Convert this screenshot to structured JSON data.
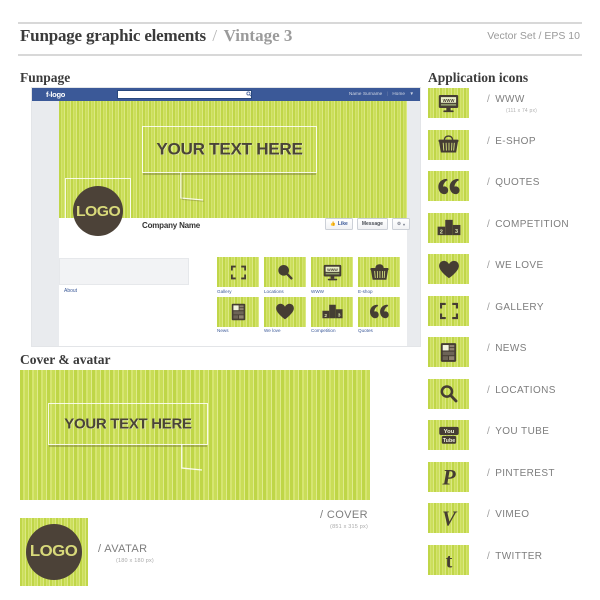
{
  "header": {
    "title_main": "Funpage graphic elements",
    "title_slash": "/",
    "title_sub": "Vintage 3",
    "right_note": "Vector Set / EPS 10"
  },
  "sections": {
    "funpage_heading": "Funpage",
    "cover_heading": "Cover & avatar",
    "appicons_heading": "Application icons"
  },
  "funpage": {
    "brand": "f-logo",
    "search_placeholder": "",
    "search_icon": "search-icon",
    "user_name": "Name Surname",
    "separator": "|",
    "home_label": "Home",
    "caret": "▼",
    "bubble_text": "YOUR TEXT HERE",
    "logo_text": "LOGO",
    "company_name": "Company Name",
    "like_label": "Like",
    "like_icon": "thumbs-up-icon",
    "message_label": "Message",
    "gear_icon": "gear-icon",
    "caret_icon": "chevron-down-icon",
    "about_label": "About",
    "grid": [
      {
        "label": "Gallery",
        "icon": "gallery-icon"
      },
      {
        "label": "Locations",
        "icon": "magnifier-icon"
      },
      {
        "label": "WWW",
        "icon": "monitor-www-icon"
      },
      {
        "label": "E-shop",
        "icon": "basket-icon"
      },
      {
        "label": "News",
        "icon": "newspaper-icon"
      },
      {
        "label": "We love",
        "icon": "heart-icon"
      },
      {
        "label": "Competition",
        "icon": "podium-icon"
      },
      {
        "label": "Quotes",
        "icon": "quotes-icon"
      }
    ]
  },
  "cover": {
    "bubble_text": "YOUR TEXT HERE",
    "label": "/  COVER",
    "dimensions": "(851 x 315 px)"
  },
  "avatar": {
    "logo_text": "LOGO",
    "label": "/  AVATAR",
    "dimensions": "(180 x 180 px)"
  },
  "app_icons": {
    "first_dimensions": "(111 x 74 px)",
    "items": [
      {
        "slash": "/",
        "label": "WWW",
        "icon": "monitor-www-icon"
      },
      {
        "slash": "/",
        "label": "E-SHOP",
        "icon": "basket-icon"
      },
      {
        "slash": "/",
        "label": "QUOTES",
        "icon": "quotes-icon"
      },
      {
        "slash": "/",
        "label": "COMPETITION",
        "icon": "podium-icon"
      },
      {
        "slash": "/",
        "label": "WE LOVE",
        "icon": "heart-icon"
      },
      {
        "slash": "/",
        "label": "GALLERY",
        "icon": "gallery-icon"
      },
      {
        "slash": "/",
        "label": "NEWS",
        "icon": "newspaper-icon"
      },
      {
        "slash": "/",
        "label": "LOCATIONS",
        "icon": "magnifier-icon"
      },
      {
        "slash": "/",
        "label": "YOU TUBE",
        "icon": "youtube-icon"
      },
      {
        "slash": "/",
        "label": "PINTEREST",
        "icon": "pinterest-icon"
      },
      {
        "slash": "/",
        "label": "VIMEO",
        "icon": "vimeo-icon"
      },
      {
        "slash": "/",
        "label": "TWITTER",
        "icon": "twitter-icon"
      }
    ]
  },
  "colors": {
    "stripe_green": "#c3d84a",
    "stripe_light": "#dbe882",
    "dark_brown": "#4c4238",
    "logo_yellow": "#d8d97a",
    "fb_blue": "#3b5998",
    "label_gray": "#7d7d7d"
  }
}
